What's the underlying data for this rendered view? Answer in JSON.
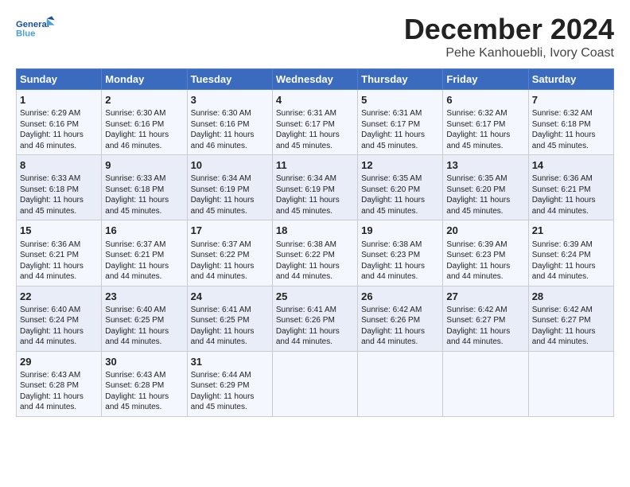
{
  "header": {
    "logo_line1": "General",
    "logo_line2": "Blue",
    "month": "December 2024",
    "location": "Pehe Kanhouebli, Ivory Coast"
  },
  "days_of_week": [
    "Sunday",
    "Monday",
    "Tuesday",
    "Wednesday",
    "Thursday",
    "Friday",
    "Saturday"
  ],
  "weeks": [
    [
      {
        "day": "1",
        "text": "Sunrise: 6:29 AM\nSunset: 6:16 PM\nDaylight: 11 hours\nand 46 minutes."
      },
      {
        "day": "2",
        "text": "Sunrise: 6:30 AM\nSunset: 6:16 PM\nDaylight: 11 hours\nand 46 minutes."
      },
      {
        "day": "3",
        "text": "Sunrise: 6:30 AM\nSunset: 6:16 PM\nDaylight: 11 hours\nand 46 minutes."
      },
      {
        "day": "4",
        "text": "Sunrise: 6:31 AM\nSunset: 6:17 PM\nDaylight: 11 hours\nand 45 minutes."
      },
      {
        "day": "5",
        "text": "Sunrise: 6:31 AM\nSunset: 6:17 PM\nDaylight: 11 hours\nand 45 minutes."
      },
      {
        "day": "6",
        "text": "Sunrise: 6:32 AM\nSunset: 6:17 PM\nDaylight: 11 hours\nand 45 minutes."
      },
      {
        "day": "7",
        "text": "Sunrise: 6:32 AM\nSunset: 6:18 PM\nDaylight: 11 hours\nand 45 minutes."
      }
    ],
    [
      {
        "day": "8",
        "text": "Sunrise: 6:33 AM\nSunset: 6:18 PM\nDaylight: 11 hours\nand 45 minutes."
      },
      {
        "day": "9",
        "text": "Sunrise: 6:33 AM\nSunset: 6:18 PM\nDaylight: 11 hours\nand 45 minutes."
      },
      {
        "day": "10",
        "text": "Sunrise: 6:34 AM\nSunset: 6:19 PM\nDaylight: 11 hours\nand 45 minutes."
      },
      {
        "day": "11",
        "text": "Sunrise: 6:34 AM\nSunset: 6:19 PM\nDaylight: 11 hours\nand 45 minutes."
      },
      {
        "day": "12",
        "text": "Sunrise: 6:35 AM\nSunset: 6:20 PM\nDaylight: 11 hours\nand 45 minutes."
      },
      {
        "day": "13",
        "text": "Sunrise: 6:35 AM\nSunset: 6:20 PM\nDaylight: 11 hours\nand 45 minutes."
      },
      {
        "day": "14",
        "text": "Sunrise: 6:36 AM\nSunset: 6:21 PM\nDaylight: 11 hours\nand 44 minutes."
      }
    ],
    [
      {
        "day": "15",
        "text": "Sunrise: 6:36 AM\nSunset: 6:21 PM\nDaylight: 11 hours\nand 44 minutes."
      },
      {
        "day": "16",
        "text": "Sunrise: 6:37 AM\nSunset: 6:21 PM\nDaylight: 11 hours\nand 44 minutes."
      },
      {
        "day": "17",
        "text": "Sunrise: 6:37 AM\nSunset: 6:22 PM\nDaylight: 11 hours\nand 44 minutes."
      },
      {
        "day": "18",
        "text": "Sunrise: 6:38 AM\nSunset: 6:22 PM\nDaylight: 11 hours\nand 44 minutes."
      },
      {
        "day": "19",
        "text": "Sunrise: 6:38 AM\nSunset: 6:23 PM\nDaylight: 11 hours\nand 44 minutes."
      },
      {
        "day": "20",
        "text": "Sunrise: 6:39 AM\nSunset: 6:23 PM\nDaylight: 11 hours\nand 44 minutes."
      },
      {
        "day": "21",
        "text": "Sunrise: 6:39 AM\nSunset: 6:24 PM\nDaylight: 11 hours\nand 44 minutes."
      }
    ],
    [
      {
        "day": "22",
        "text": "Sunrise: 6:40 AM\nSunset: 6:24 PM\nDaylight: 11 hours\nand 44 minutes."
      },
      {
        "day": "23",
        "text": "Sunrise: 6:40 AM\nSunset: 6:25 PM\nDaylight: 11 hours\nand 44 minutes."
      },
      {
        "day": "24",
        "text": "Sunrise: 6:41 AM\nSunset: 6:25 PM\nDaylight: 11 hours\nand 44 minutes."
      },
      {
        "day": "25",
        "text": "Sunrise: 6:41 AM\nSunset: 6:26 PM\nDaylight: 11 hours\nand 44 minutes."
      },
      {
        "day": "26",
        "text": "Sunrise: 6:42 AM\nSunset: 6:26 PM\nDaylight: 11 hours\nand 44 minutes."
      },
      {
        "day": "27",
        "text": "Sunrise: 6:42 AM\nSunset: 6:27 PM\nDaylight: 11 hours\nand 44 minutes."
      },
      {
        "day": "28",
        "text": "Sunrise: 6:42 AM\nSunset: 6:27 PM\nDaylight: 11 hours\nand 44 minutes."
      }
    ],
    [
      {
        "day": "29",
        "text": "Sunrise: 6:43 AM\nSunset: 6:28 PM\nDaylight: 11 hours\nand 44 minutes."
      },
      {
        "day": "30",
        "text": "Sunrise: 6:43 AM\nSunset: 6:28 PM\nDaylight: 11 hours\nand 45 minutes."
      },
      {
        "day": "31",
        "text": "Sunrise: 6:44 AM\nSunset: 6:29 PM\nDaylight: 11 hours\nand 45 minutes."
      },
      {
        "day": "",
        "text": ""
      },
      {
        "day": "",
        "text": ""
      },
      {
        "day": "",
        "text": ""
      },
      {
        "day": "",
        "text": ""
      }
    ]
  ]
}
